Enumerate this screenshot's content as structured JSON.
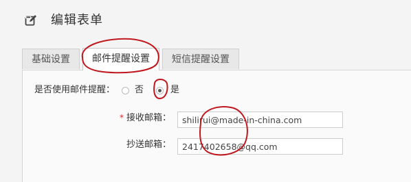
{
  "header": {
    "title": "编辑表单",
    "icon": "edit-icon"
  },
  "tabs": [
    {
      "label": "基础设置",
      "active": false
    },
    {
      "label": "邮件提醒设置",
      "active": true
    },
    {
      "label": "短信提醒设置",
      "active": false
    }
  ],
  "form": {
    "email_reminder": {
      "label": "是否使用邮件提醒：",
      "options": [
        "否",
        "是"
      ],
      "selected": "是"
    },
    "receive_email": {
      "required_mark": "*",
      "label": "接收邮箱：",
      "value": "shilirui@made-in-china.com"
    },
    "cc_email": {
      "label": "抄送邮箱：",
      "value": "2417402658@qq.com"
    }
  },
  "colors": {
    "annotation_red": "#c0171d",
    "required_red": "#e02424",
    "background": "#f4f4f4"
  }
}
